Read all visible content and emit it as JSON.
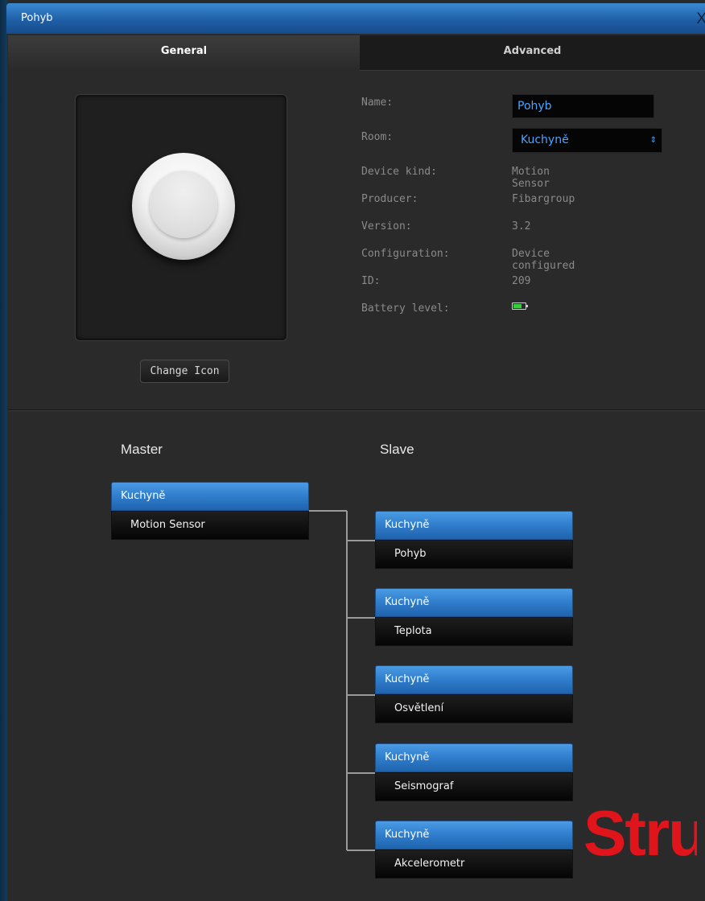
{
  "window": {
    "title": "Pohyb",
    "close_label": "X"
  },
  "tabs": [
    {
      "label": "General",
      "active": true
    },
    {
      "label": "Advanced",
      "active": false
    }
  ],
  "icon_panel": {
    "icon_name": "motion-sensor-icon",
    "change_button_label": "Change Icon"
  },
  "properties": {
    "name_label": "Name:",
    "name_value": "Pohyb",
    "room_label": "Room:",
    "room_value": "Kuchyně",
    "device_kind_label": "Device kind:",
    "device_kind_value": "Motion Sensor",
    "producer_label": "Producer:",
    "producer_value": "Fibargroup",
    "version_label": "Version:",
    "version_value": "3.2",
    "configuration_label": "Configuration:",
    "configuration_value": "Device configured",
    "id_label": "ID:",
    "id_value": "209",
    "battery_label": "Battery level:",
    "battery_icon": "battery-icon",
    "battery_level_fraction": 0.6
  },
  "hierarchy": {
    "master_heading": "Master",
    "slave_heading": "Slave",
    "master": {
      "room": "Kuchyně",
      "device": "Motion Sensor"
    },
    "slaves": [
      {
        "room": "Kuchyně",
        "device": "Pohyb"
      },
      {
        "room": "Kuchyně",
        "device": "Teplota"
      },
      {
        "room": "Kuchyně",
        "device": "Osvětlení"
      },
      {
        "room": "Kuchyně",
        "device": "Seismograf"
      },
      {
        "room": "Kuchyně",
        "device": "Akcelerometr"
      }
    ]
  },
  "watermark": {
    "text": "Stru",
    "color": "#e0141b"
  },
  "colors": {
    "accent_blue": "#2f7dcc",
    "input_text": "#4ea3ff",
    "battery_green": "#2fd23a"
  }
}
